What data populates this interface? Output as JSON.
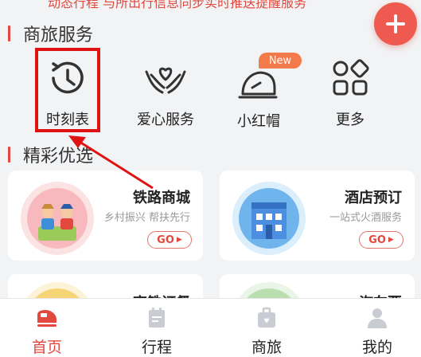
{
  "top_banner_text": "动态行程 与所出行信息同步实时推送提醒服务",
  "add_button_icon": "plus-icon",
  "sections": {
    "services_title": "商旅服务",
    "featured_title": "精彩优选"
  },
  "services": [
    {
      "label": "时刻表",
      "icon": "clock-icon"
    },
    {
      "label": "爱心服务",
      "icon": "heart-hands-icon"
    },
    {
      "label": "小红帽",
      "icon": "cap-icon",
      "badge": "New"
    },
    {
      "label": "更多",
      "icon": "grid-icon"
    }
  ],
  "cards": [
    {
      "name": "铁路商城",
      "subtitle": "乡村振兴 帮扶先行",
      "button": "GO"
    },
    {
      "name": "酒店预订",
      "subtitle": "一站式火酒服务",
      "button": "GO"
    },
    {
      "name": "高铁订餐"
    },
    {
      "name": "汽车票"
    }
  ],
  "tabs": [
    {
      "label": "首页",
      "icon": "train-icon",
      "active": true
    },
    {
      "label": "行程",
      "icon": "itinerary-icon"
    },
    {
      "label": "商旅",
      "icon": "luggage-icon"
    },
    {
      "label": "我的",
      "icon": "user-icon"
    }
  ],
  "colors": {
    "accent": "#e2483d",
    "highlight_box": "#e01313",
    "badge": "#f27a4b"
  }
}
